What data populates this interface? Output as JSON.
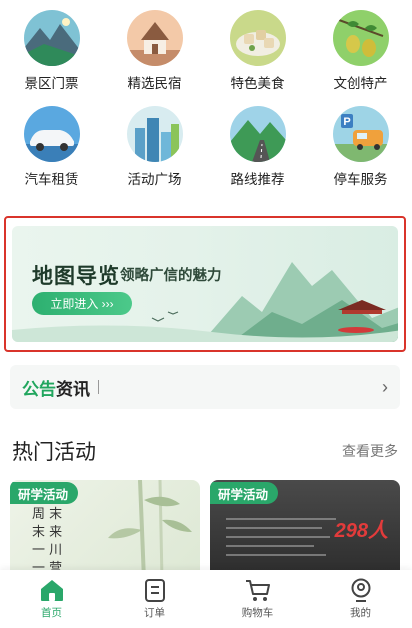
{
  "categories": [
    {
      "label": "景区门票",
      "icon": "mountain-lake-icon"
    },
    {
      "label": "精选民宿",
      "icon": "house-icon"
    },
    {
      "label": "特色美食",
      "icon": "food-plate-icon"
    },
    {
      "label": "文创特产",
      "icon": "fruit-branch-icon"
    },
    {
      "label": "汽车租赁",
      "icon": "car-icon"
    },
    {
      "label": "活动广场",
      "icon": "city-buildings-icon"
    },
    {
      "label": "路线推荐",
      "icon": "road-mountain-icon"
    },
    {
      "label": "停车服务",
      "icon": "parking-icon"
    }
  ],
  "banner": {
    "title": "地图导览",
    "subtitle": "领略广信的魅力",
    "button": "立即进入 ›››"
  },
  "notice": {
    "label_a": "公告",
    "label_b": "资讯",
    "arrow": "›"
  },
  "hot": {
    "title": "热门活动",
    "more": "查看更多",
    "cards": [
      {
        "tag": "研学活动"
      },
      {
        "tag": "研学活动",
        "highlight": "298人"
      }
    ]
  },
  "tabbar": {
    "items": [
      {
        "label": "首页",
        "icon": "home-icon"
      },
      {
        "label": "订单",
        "icon": "order-icon"
      },
      {
        "label": "购物车",
        "icon": "cart-icon"
      },
      {
        "label": "我的",
        "icon": "profile-icon"
      }
    ]
  },
  "colors": {
    "accent": "#2aa76a",
    "highlight_border": "#d9342b"
  }
}
